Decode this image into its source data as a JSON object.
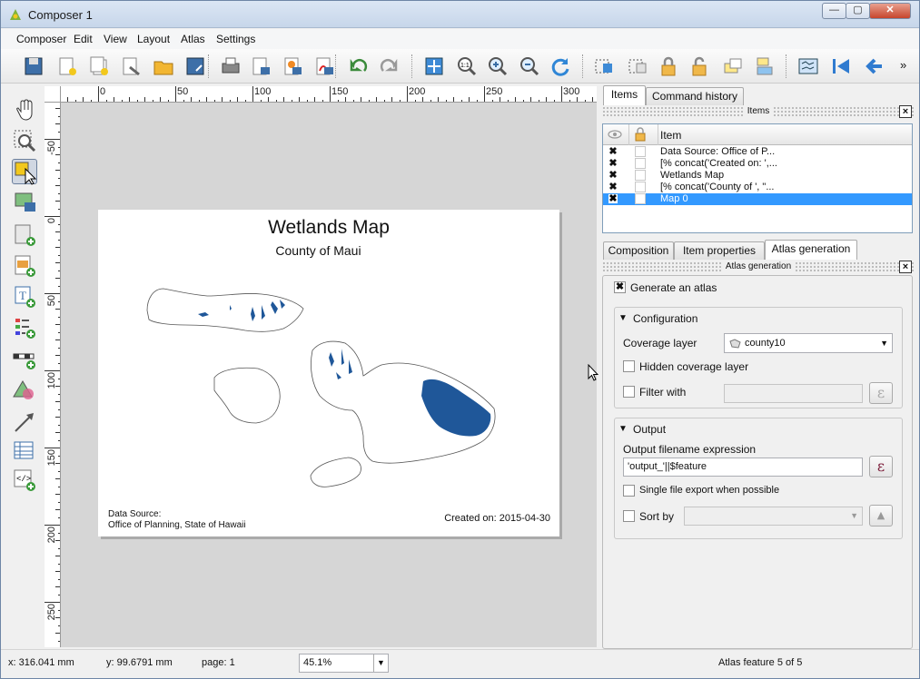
{
  "window": {
    "title": "Composer 1",
    "min_label": "—",
    "max_label": "▢",
    "close_label": "✕"
  },
  "menu": [
    "Composer",
    "Edit",
    "View",
    "Layout",
    "Atlas",
    "Settings"
  ],
  "toolbar_icons": [
    "save-icon",
    "new-composer-icon",
    "duplicate-composer-icon",
    "composer-manager-icon",
    "open-template-icon",
    "save-template-icon",
    "print-icon",
    "export-image-icon",
    "export-svg-icon",
    "export-pdf-icon",
    "undo-icon",
    "redo-icon",
    "zoom-full-icon",
    "zoom-actual-icon",
    "zoom-in-icon",
    "zoom-out-icon",
    "refresh-icon",
    "select-all-icon",
    "deselect-icon",
    "lock-icon",
    "unlock-icon",
    "raise-items-icon",
    "align-items-icon",
    "atlas-preview-icon",
    "first-feature-icon",
    "previous-feature-icon"
  ],
  "toolbar_overflow": "»",
  "left_tools": [
    "pan-icon",
    "zoom-tool-icon",
    "select-move-icon",
    "move-content-icon",
    "add-map-icon",
    "add-image-icon",
    "add-label-icon",
    "add-legend-icon",
    "add-scalebar-icon",
    "add-shape-icon",
    "add-arrow-icon",
    "add-table-icon",
    "add-html-icon"
  ],
  "ruler_top": [
    "0",
    "50",
    "100",
    "150",
    "200",
    "250",
    "300"
  ],
  "ruler_left": [
    "-50",
    "0",
    "50",
    "100",
    "150",
    "200",
    "250"
  ],
  "page": {
    "title": "Wetlands Map",
    "subtitle": "County of Maui",
    "source_line1": "Data Source:",
    "source_line2": "Office of Planning, State of Hawaii",
    "created": "Created on: 2015-04-30"
  },
  "top_tabs": [
    "Items",
    "Command history"
  ],
  "items_panel": {
    "header": "Items",
    "col_item": "Item",
    "rows": [
      {
        "label": "Data Source: Office of P...",
        "selected": false
      },
      {
        "label": "[% concat('Created on: ',...",
        "selected": false
      },
      {
        "label": "Wetlands Map",
        "selected": false
      },
      {
        "label": "[% concat('County of ', \"...",
        "selected": false
      },
      {
        "label": "Map 0",
        "selected": true
      }
    ]
  },
  "bottom_tabs": [
    "Composition",
    "Item properties",
    "Atlas generation"
  ],
  "atlas": {
    "header": "Atlas generation",
    "generate_label": "Generate an atlas",
    "configuration_label": "Configuration",
    "coverage_label": "Coverage layer",
    "coverage_value": "county10",
    "hidden_label": "Hidden coverage layer",
    "filter_label": "Filter with",
    "output_label": "Output",
    "filename_expr_label": "Output filename expression",
    "filename_expr_value": "'output_'||$feature",
    "single_file_label": "Single file export when possible",
    "sort_label": "Sort by",
    "epsilon": "ε",
    "dropdown_arrow": "▼",
    "sort_dir": "▲"
  },
  "status": {
    "x": "x: 316.041 mm",
    "y": "y: 99.6791 mm",
    "page": "page: 1",
    "zoom": "45.1%",
    "atlas_feature": "Atlas feature 5 of 5"
  },
  "colors": {
    "wetland": "#1f5799",
    "accent": "#3399ff"
  }
}
